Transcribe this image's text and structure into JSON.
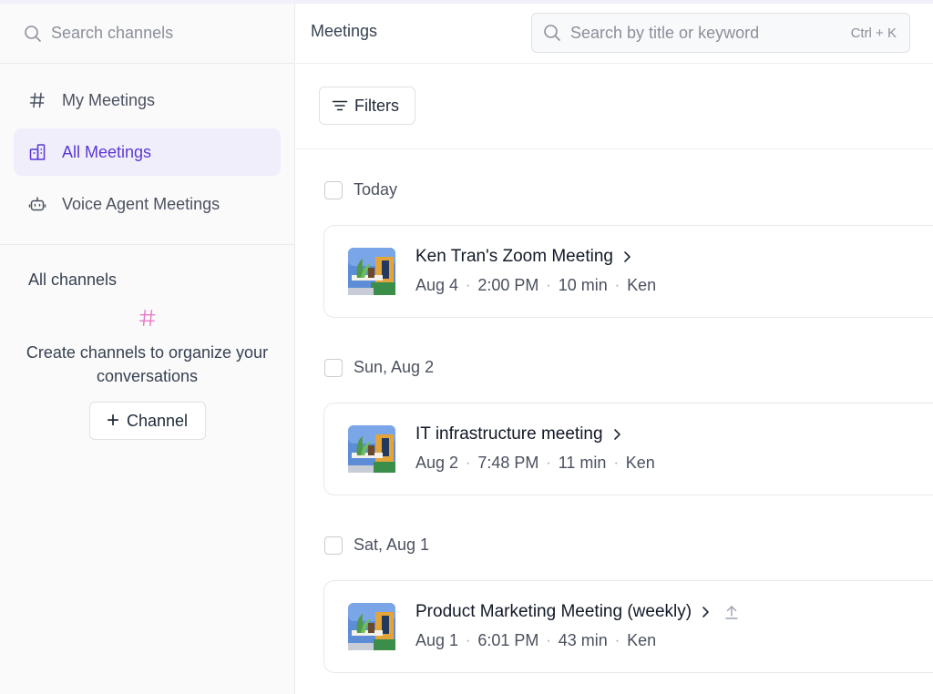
{
  "sidebar": {
    "search_placeholder": "Search channels",
    "nav": [
      {
        "label": "My Meetings",
        "icon": "hash-icon"
      },
      {
        "label": "All Meetings",
        "icon": "meetings-building-icon",
        "active": true
      },
      {
        "label": "Voice Agent Meetings",
        "icon": "robot-icon"
      }
    ],
    "channels_title": "All channels",
    "empty_text": "Create channels to organize your conversations",
    "channel_button": "Channel"
  },
  "main": {
    "title": "Meetings",
    "search_placeholder": "Search by title or keyword",
    "search_shortcut": "Ctrl + K",
    "filters_label": "Filters",
    "groups": [
      {
        "label": "Today",
        "meeting": {
          "title": "Ken Tran's Zoom Meeting",
          "date": "Aug 4",
          "time": "2:00 PM",
          "duration": "10 min",
          "owner": "Ken"
        }
      },
      {
        "label": "Sun, Aug 2",
        "meeting": {
          "title": "IT infrastructure meeting",
          "date": "Aug 2",
          "time": "7:48 PM",
          "duration": "11 min",
          "owner": "Ken"
        }
      },
      {
        "label": "Sat, Aug 1",
        "meeting": {
          "title": "Product Marketing Meeting (weekly)",
          "date": "Aug 1",
          "time": "6:01 PM",
          "duration": "43 min",
          "owner": "Ken"
        }
      }
    ]
  },
  "colors": {
    "accent": "#5b37d4",
    "accent_bg": "#f1eefc",
    "hash_pink": "#e879c9"
  }
}
